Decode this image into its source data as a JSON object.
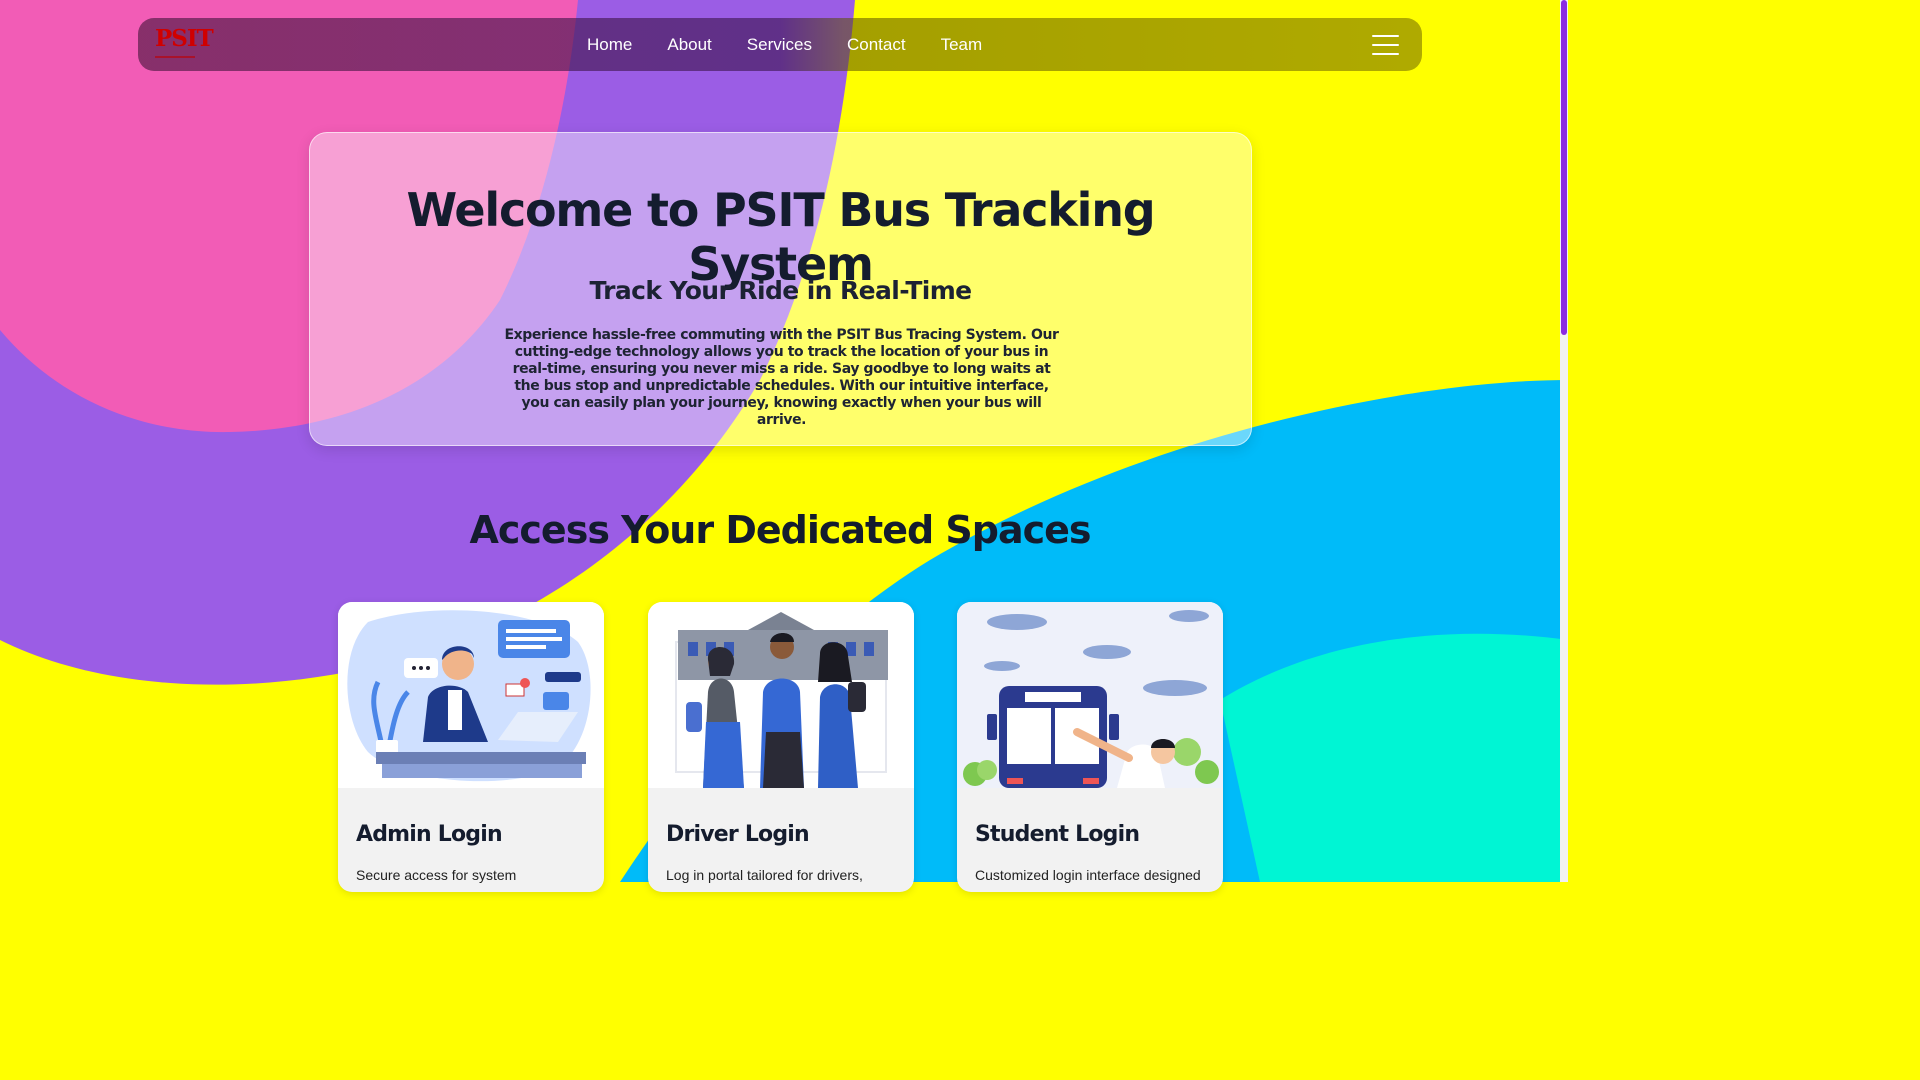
{
  "navbar": {
    "logo_text": "PSIT",
    "links": [
      "Home",
      "About",
      "Services",
      "Contact",
      "Team"
    ]
  },
  "hero": {
    "title": "Welcome to PSIT Bus Tracking System",
    "subtitle": "Track Your Ride in Real-Time",
    "description": "Experience hassle-free commuting with the PSIT Bus Tracing System. Our cutting-edge technology allows you to track the location of your bus in real-time, ensuring you never miss a ride. Say goodbye to long waits at the bus stop and unpredictable schedules. With our intuitive interface, you can easily plan your journey, knowing exactly when your bus will arrive."
  },
  "section": {
    "title": "Access Your Dedicated Spaces"
  },
  "cards": [
    {
      "title": "Admin Login",
      "description": "Secure access for system",
      "illustration": "admin-support-illustration"
    },
    {
      "title": "Driver Login",
      "description": "Log in portal tailored for drivers,",
      "illustration": "students-campus-illustration"
    },
    {
      "title": "Student Login",
      "description": "Customized login interface designed",
      "illustration": "bus-stop-illustration"
    }
  ],
  "colors": {
    "pink": "#f25cb6",
    "purple": "#9b5de5",
    "yellow": "#ffff00",
    "sky": "#00bbf9",
    "teal": "#00f5d4",
    "logo_red": "#d00000",
    "heading": "#141c2e"
  },
  "icons": {
    "menu": "hamburger-menu-icon"
  }
}
